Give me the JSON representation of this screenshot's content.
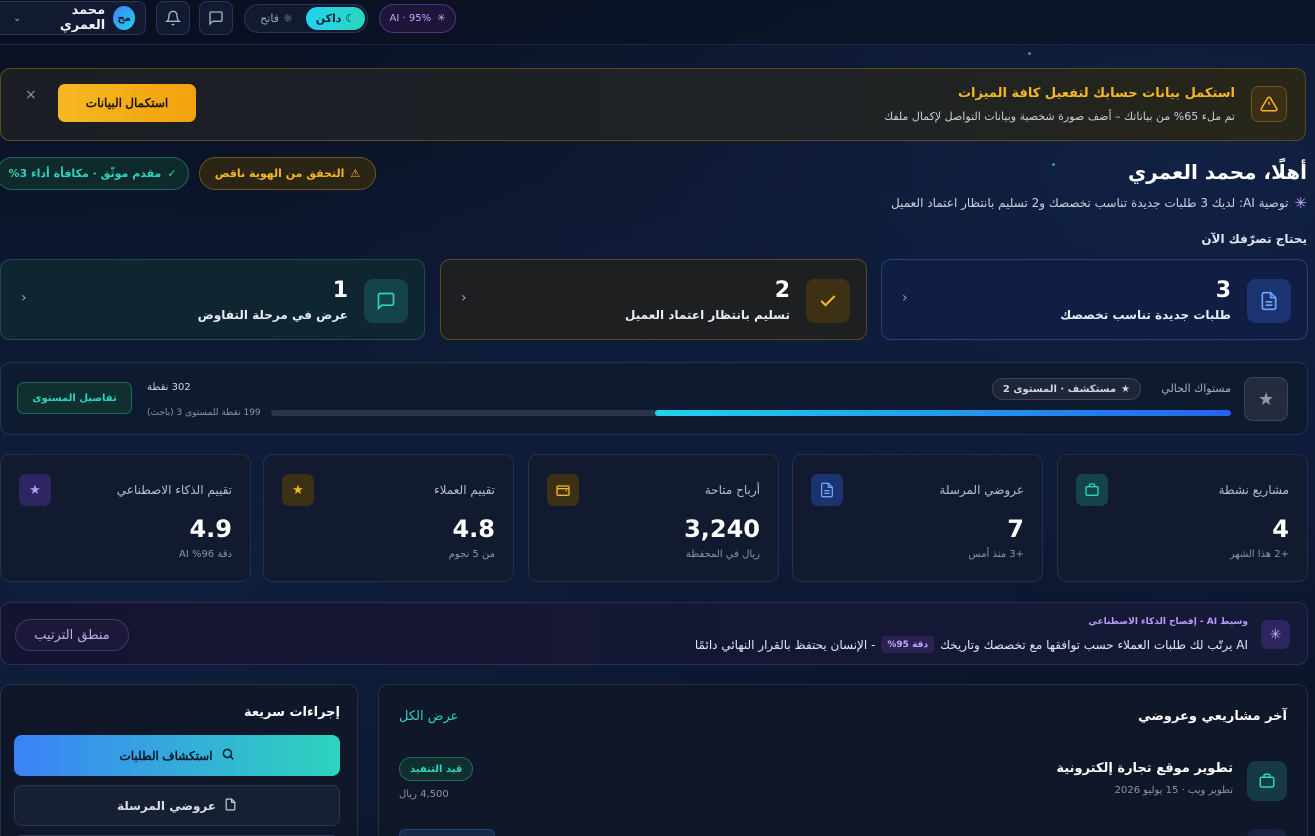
{
  "topbar": {
    "user_name": "محمد العمري",
    "avatar_initials": "مح",
    "theme_dark": "داكن",
    "theme_light": "فاتح",
    "ai_badge": "AI · 95%"
  },
  "banner": {
    "title": "استكمل بيانات حسابك لتفعيل كافة الميزات",
    "subtitle": "تم ملء 65% من بياناتك – أضف صورة شخصية وبيانات التواصل لإكمال ملفك",
    "cta": "استكمال البيانات",
    "close": "×"
  },
  "greeting": {
    "title": "أهلًا، محمد العمري",
    "ai_recommendation": "توصية AI: لديك 3 طلبات جديدة تناسب تخصصك و2 تسليم بانتظار اعتماد العميل",
    "badge_identity": "التحقق من الهوية ناقص",
    "badge_verified": "مقدم موثّق · مكافأة أداء 3%"
  },
  "needs_action": {
    "heading": "يحتاج تصرّفك الآن",
    "cards": [
      {
        "count": "3",
        "label": "طلبات جديدة تناسب تخصصك"
      },
      {
        "count": "2",
        "label": "تسليم بانتظار اعتماد العميل"
      },
      {
        "count": "1",
        "label": "عرض في مرحلة التفاوض"
      }
    ]
  },
  "level": {
    "current_label": "مستواك الحالي",
    "level_name": "مستكشف · المستوى 2",
    "points": "302 نقطة",
    "remaining": "199 نقطة للمستوى 3 (باحث)",
    "progress_percent": 60,
    "details_button": "تفاصيل المستوى"
  },
  "stats": [
    {
      "label": "مشاريع نشطة",
      "value": "4",
      "sub": "+2 هذا الشهر"
    },
    {
      "label": "عروضي المرسلة",
      "value": "7",
      "sub": "+3 منذ أمس"
    },
    {
      "label": "أرباح متاحة",
      "value": "3,240",
      "sub": "ريال في المحفظة"
    },
    {
      "label": "تقييم العملاء",
      "value": "4.8",
      "sub": "من 5 نجوم"
    },
    {
      "label": "تقييم الذكاء الاصطناعي",
      "value": "4.9",
      "sub": "دقة 96% AI"
    }
  ],
  "ai_transparency": {
    "title": "وسيط AI - إفصاح الذكاء الاصطناعي",
    "text_before": "AI يرتّب لك طلبات العملاء حسب توافقها مع تخصصك وتاريخك",
    "accuracy": "دقة 95%",
    "text_after": "- الإنسان يحتفظ بالقرار النهائي دائمًا",
    "logic_button": "منطق الترتيب"
  },
  "quick_actions": {
    "heading": "إجراءات سريعة",
    "explore": "استكشاف الطلبات",
    "my_offers": "عروضي المرسلة"
  },
  "projects": {
    "heading": "آخر مشاريعي وعروضي",
    "view_all": "عرض الكل",
    "items": [
      {
        "title": "تطوير موقع تجارة إلكترونية",
        "meta": "تطوير ويب · 15 يوليو 2026",
        "status": "قيد التنفيذ",
        "price": "4,500 ريال"
      }
    ]
  },
  "colors": {
    "accent": "#2dd4bf",
    "warning": "#f5b823",
    "ai": "#c4a7ff",
    "background": "#0b1226"
  }
}
